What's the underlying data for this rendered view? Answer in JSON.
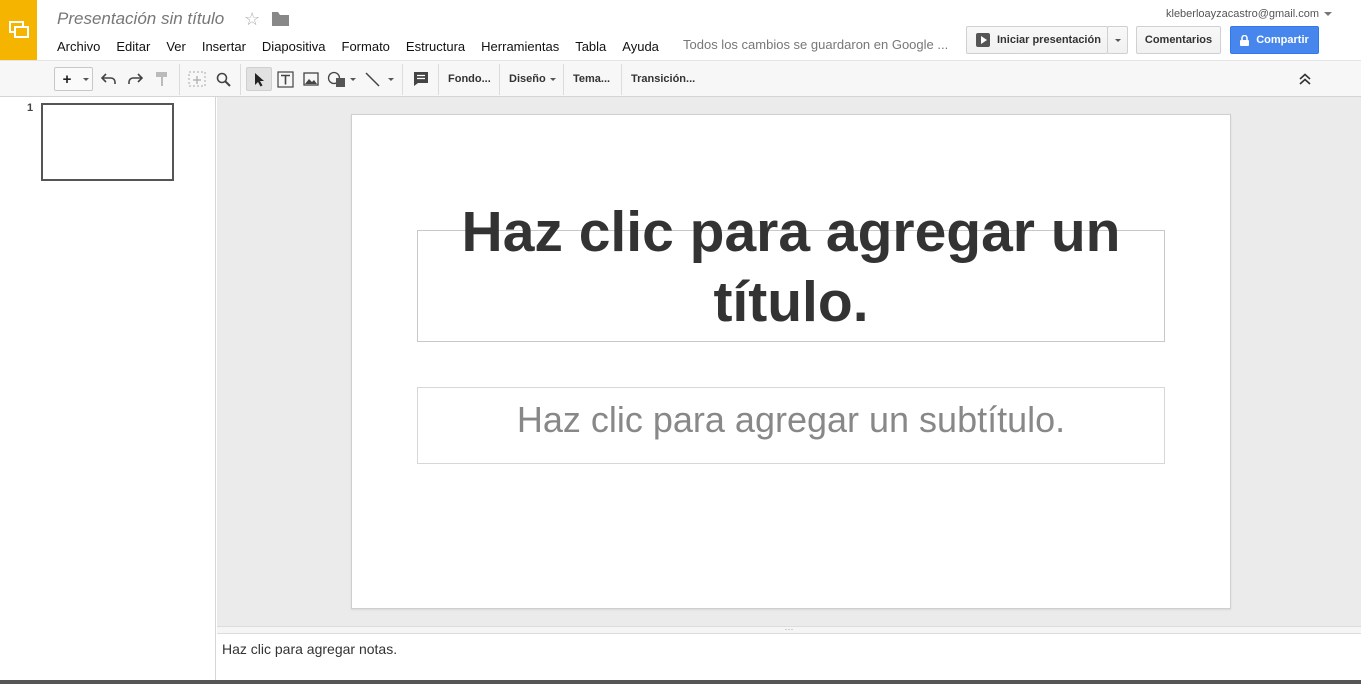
{
  "header": {
    "doc_title": "Presentación sin título",
    "save_status": "Todos los cambios se guardaron en Google ...",
    "account_email": "kleberloayzacastro@gmail.com",
    "present_label": "Iniciar presentación",
    "comments_label": "Comentarios",
    "share_label": "Compartir",
    "brand_color": "#f4b400",
    "share_color": "#4787ed"
  },
  "menu": [
    {
      "label": "Archivo"
    },
    {
      "label": "Editar"
    },
    {
      "label": "Ver"
    },
    {
      "label": "Insertar"
    },
    {
      "label": "Diapositiva"
    },
    {
      "label": "Formato"
    },
    {
      "label": "Estructura"
    },
    {
      "label": "Herramientas"
    },
    {
      "label": "Tabla"
    },
    {
      "label": "Ayuda"
    }
  ],
  "toolbar": {
    "new_slide_label": "+",
    "background_label": "Fondo...",
    "layout_label": "Diseño",
    "theme_label": "Tema...",
    "transition_label": "Transición..."
  },
  "filmstrip": {
    "slides": [
      {
        "number": "1"
      }
    ]
  },
  "slide": {
    "title_placeholder": "Haz clic para agregar un título.",
    "subtitle_placeholder": "Haz clic para agregar un subtítulo."
  },
  "notes": {
    "placeholder": "Haz clic para agregar notas."
  }
}
